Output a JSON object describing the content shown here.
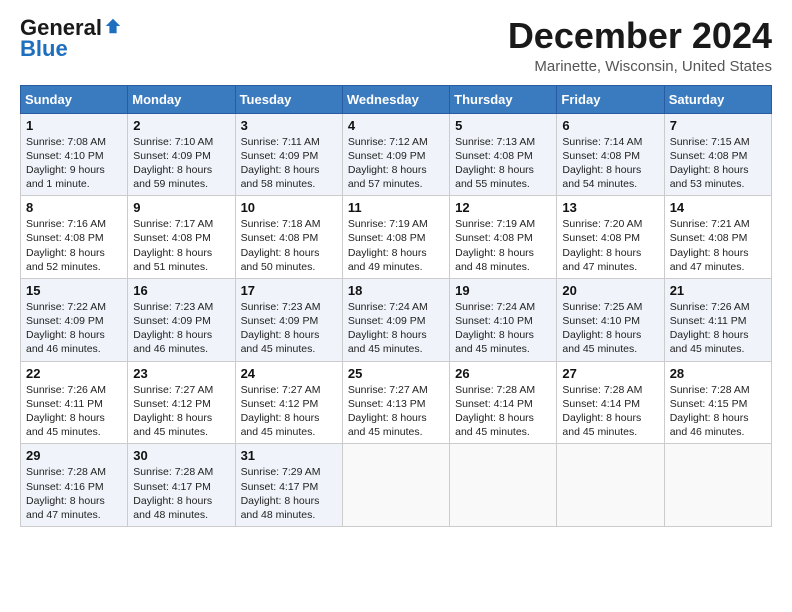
{
  "header": {
    "logo_general": "General",
    "logo_blue": "Blue",
    "month_title": "December 2024",
    "location": "Marinette, Wisconsin, United States"
  },
  "days_of_week": [
    "Sunday",
    "Monday",
    "Tuesday",
    "Wednesday",
    "Thursday",
    "Friday",
    "Saturday"
  ],
  "weeks": [
    [
      {
        "day": "1",
        "sunrise": "7:08 AM",
        "sunset": "4:10 PM",
        "daylight": "9 hours and 1 minute."
      },
      {
        "day": "2",
        "sunrise": "7:10 AM",
        "sunset": "4:09 PM",
        "daylight": "8 hours and 59 minutes."
      },
      {
        "day": "3",
        "sunrise": "7:11 AM",
        "sunset": "4:09 PM",
        "daylight": "8 hours and 58 minutes."
      },
      {
        "day": "4",
        "sunrise": "7:12 AM",
        "sunset": "4:09 PM",
        "daylight": "8 hours and 57 minutes."
      },
      {
        "day": "5",
        "sunrise": "7:13 AM",
        "sunset": "4:08 PM",
        "daylight": "8 hours and 55 minutes."
      },
      {
        "day": "6",
        "sunrise": "7:14 AM",
        "sunset": "4:08 PM",
        "daylight": "8 hours and 54 minutes."
      },
      {
        "day": "7",
        "sunrise": "7:15 AM",
        "sunset": "4:08 PM",
        "daylight": "8 hours and 53 minutes."
      }
    ],
    [
      {
        "day": "8",
        "sunrise": "7:16 AM",
        "sunset": "4:08 PM",
        "daylight": "8 hours and 52 minutes."
      },
      {
        "day": "9",
        "sunrise": "7:17 AM",
        "sunset": "4:08 PM",
        "daylight": "8 hours and 51 minutes."
      },
      {
        "day": "10",
        "sunrise": "7:18 AM",
        "sunset": "4:08 PM",
        "daylight": "8 hours and 50 minutes."
      },
      {
        "day": "11",
        "sunrise": "7:19 AM",
        "sunset": "4:08 PM",
        "daylight": "8 hours and 49 minutes."
      },
      {
        "day": "12",
        "sunrise": "7:19 AM",
        "sunset": "4:08 PM",
        "daylight": "8 hours and 48 minutes."
      },
      {
        "day": "13",
        "sunrise": "7:20 AM",
        "sunset": "4:08 PM",
        "daylight": "8 hours and 47 minutes."
      },
      {
        "day": "14",
        "sunrise": "7:21 AM",
        "sunset": "4:08 PM",
        "daylight": "8 hours and 47 minutes."
      }
    ],
    [
      {
        "day": "15",
        "sunrise": "7:22 AM",
        "sunset": "4:09 PM",
        "daylight": "8 hours and 46 minutes."
      },
      {
        "day": "16",
        "sunrise": "7:23 AM",
        "sunset": "4:09 PM",
        "daylight": "8 hours and 46 minutes."
      },
      {
        "day": "17",
        "sunrise": "7:23 AM",
        "sunset": "4:09 PM",
        "daylight": "8 hours and 45 minutes."
      },
      {
        "day": "18",
        "sunrise": "7:24 AM",
        "sunset": "4:09 PM",
        "daylight": "8 hours and 45 minutes."
      },
      {
        "day": "19",
        "sunrise": "7:24 AM",
        "sunset": "4:10 PM",
        "daylight": "8 hours and 45 minutes."
      },
      {
        "day": "20",
        "sunrise": "7:25 AM",
        "sunset": "4:10 PM",
        "daylight": "8 hours and 45 minutes."
      },
      {
        "day": "21",
        "sunrise": "7:26 AM",
        "sunset": "4:11 PM",
        "daylight": "8 hours and 45 minutes."
      }
    ],
    [
      {
        "day": "22",
        "sunrise": "7:26 AM",
        "sunset": "4:11 PM",
        "daylight": "8 hours and 45 minutes."
      },
      {
        "day": "23",
        "sunrise": "7:27 AM",
        "sunset": "4:12 PM",
        "daylight": "8 hours and 45 minutes."
      },
      {
        "day": "24",
        "sunrise": "7:27 AM",
        "sunset": "4:12 PM",
        "daylight": "8 hours and 45 minutes."
      },
      {
        "day": "25",
        "sunrise": "7:27 AM",
        "sunset": "4:13 PM",
        "daylight": "8 hours and 45 minutes."
      },
      {
        "day": "26",
        "sunrise": "7:28 AM",
        "sunset": "4:14 PM",
        "daylight": "8 hours and 45 minutes."
      },
      {
        "day": "27",
        "sunrise": "7:28 AM",
        "sunset": "4:14 PM",
        "daylight": "8 hours and 45 minutes."
      },
      {
        "day": "28",
        "sunrise": "7:28 AM",
        "sunset": "4:15 PM",
        "daylight": "8 hours and 46 minutes."
      }
    ],
    [
      {
        "day": "29",
        "sunrise": "7:28 AM",
        "sunset": "4:16 PM",
        "daylight": "8 hours and 47 minutes."
      },
      {
        "day": "30",
        "sunrise": "7:28 AM",
        "sunset": "4:17 PM",
        "daylight": "8 hours and 48 minutes."
      },
      {
        "day": "31",
        "sunrise": "7:29 AM",
        "sunset": "4:17 PM",
        "daylight": "8 hours and 48 minutes."
      },
      null,
      null,
      null,
      null
    ]
  ],
  "labels": {
    "sunrise": "Sunrise:",
    "sunset": "Sunset:",
    "daylight": "Daylight:"
  }
}
